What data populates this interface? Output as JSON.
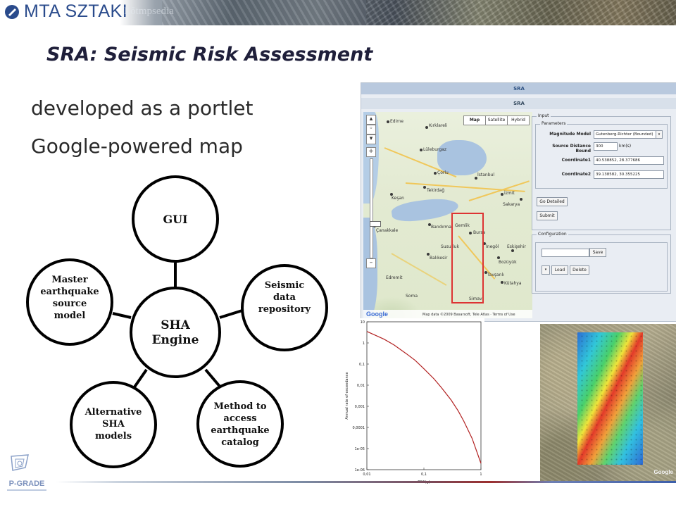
{
  "header": {
    "logo_text": "MTA SZTAKI",
    "faint_text": "Lŏtmpsedia"
  },
  "slide": {
    "title": "SRA: Seismic Risk Assessment",
    "bullets": [
      "developed as a portlet",
      "Google-powered map"
    ]
  },
  "diagram": {
    "center": [
      "SHA",
      "Engine"
    ],
    "nodes": [
      {
        "lines": [
          "GUI"
        ]
      },
      {
        "lines": [
          "Seismic",
          "data",
          "repository"
        ]
      },
      {
        "lines": [
          "Method to",
          "access",
          "earthquake",
          "catalog"
        ]
      },
      {
        "lines": [
          "Alternative",
          "SHA",
          "models"
        ]
      },
      {
        "lines": [
          "Master",
          "earthquake",
          "source",
          "model"
        ]
      }
    ]
  },
  "portlet": {
    "outer_title": "SRA",
    "inner_title": "SRA",
    "map": {
      "types": [
        "Map",
        "Satellite",
        "Hybrid"
      ],
      "zoom_in": "+",
      "zoom_out": "–",
      "cities": [
        "Kırklareli",
        "Edirne",
        "Lüleburgaz",
        "Çorlu",
        "Tekirdağ",
        "Keşan",
        "İstanbul",
        "İzmit",
        "Sakarya",
        "Bandırma",
        "Çanakkale",
        "Bursa",
        "Gemlik",
        "Balıkesir",
        "Kütahya",
        "Bozüyük",
        "Eskişehir",
        "İnegöl",
        "Susurluk",
        "Tavşanlı",
        "Edremit",
        "Soma",
        "Simav"
      ],
      "google_label": "Google",
      "attribution": "Map data ©2009 Basarsoft, Tele Atlas · Terms of Use"
    },
    "form": {
      "input_legend": "Input",
      "parameters_legend": "Parameters",
      "magnitude_label": "Magnitude Model",
      "magnitude_value": "Gutenberg-Richter (Bounded)",
      "distance_label": "Source Distance Bound",
      "distance_value": "300",
      "distance_unit": "km(s)",
      "coord1_label": "Coordinate1",
      "coord1_value": "40.538852, 28.377686",
      "coord2_label": "Coordinate2",
      "coord2_value": "39.138582, 30.355225",
      "go_detailed": "Go Detailed",
      "submit": "Submit",
      "config_legend": "Configuration",
      "config_input": "",
      "save": "Save",
      "load": "Load",
      "delete": "Delete"
    }
  },
  "chart_data": {
    "type": "line",
    "title": "",
    "xlabel": "PGA(g)",
    "ylabel": "Annual rate of exceedance",
    "xscale": "log",
    "yscale": "log",
    "xlim": [
      0.01,
      1
    ],
    "ylim": [
      1e-06,
      10
    ],
    "x_ticks": [
      "0,01",
      "0,1",
      "1"
    ],
    "y_ticks": [
      "10",
      "1",
      "0,1",
      "0,01",
      "0,001",
      "0,0001",
      "1e-05",
      "1e-06"
    ],
    "series": [
      {
        "color": "#b22222",
        "x": [
          0.01,
          0.02,
          0.03,
          0.05,
          0.07,
          0.1,
          0.15,
          0.2,
          0.3,
          0.4,
          0.5,
          0.7,
          1.0
        ],
        "y": [
          3.5,
          1.5,
          0.8,
          0.3,
          0.15,
          0.06,
          0.02,
          0.008,
          0.002,
          0.0006,
          0.0002,
          3e-05,
          2e-06
        ]
      }
    ],
    "grid": false,
    "legend": "none"
  },
  "hazard_map": {
    "google_label": "Google"
  },
  "footer": {
    "logo_text": "P-GRADE"
  }
}
